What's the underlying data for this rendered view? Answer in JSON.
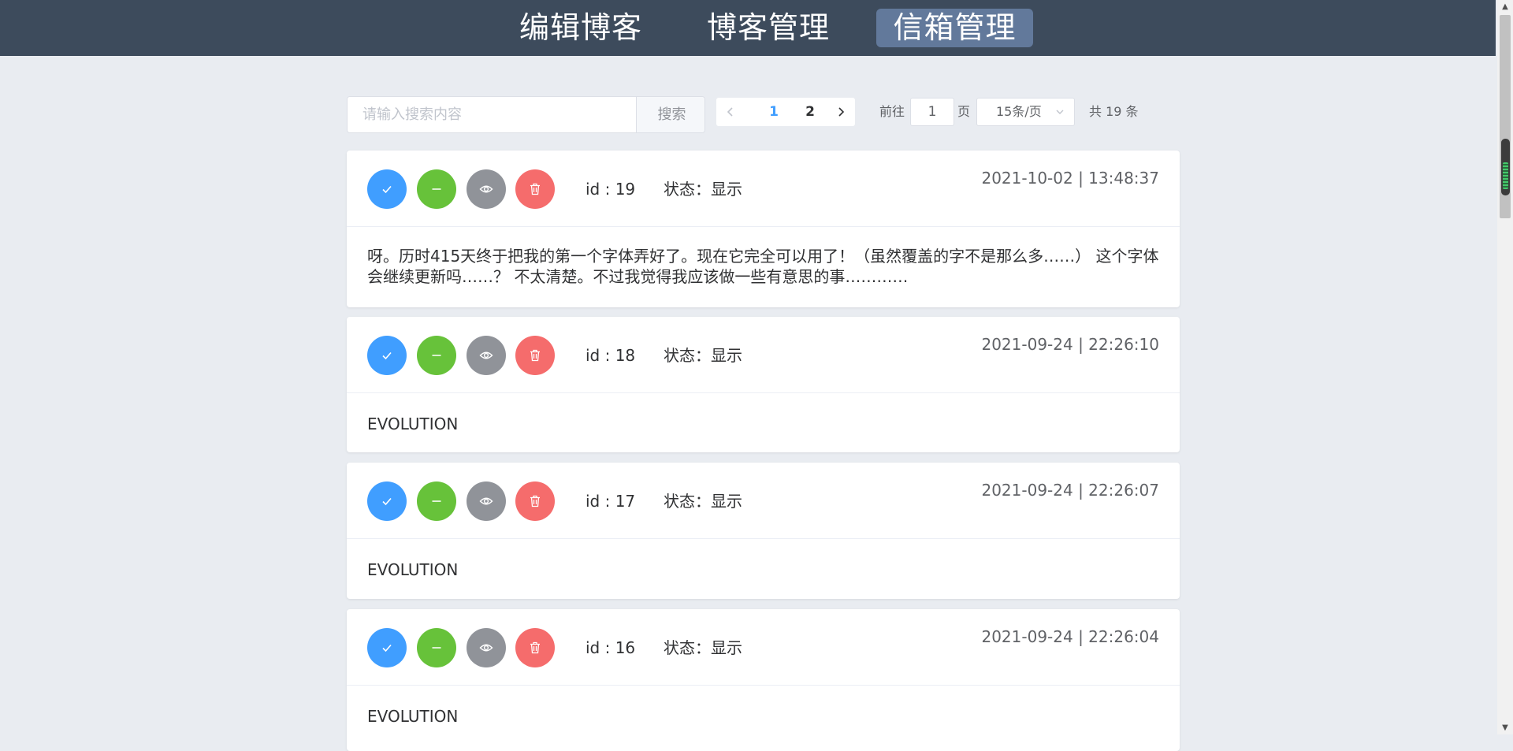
{
  "nav": {
    "items": [
      {
        "label": "编辑博客",
        "active": false
      },
      {
        "label": "博客管理",
        "active": false
      },
      {
        "label": "信箱管理",
        "active": true
      }
    ]
  },
  "toolbar": {
    "search_placeholder": "请输入搜索内容",
    "search_button": "搜索"
  },
  "pagination": {
    "prev_icon": "chevron-left-icon",
    "next_icon": "chevron-right-icon",
    "pages": [
      "1",
      "2"
    ],
    "current_page": "1",
    "goto_label": "前往",
    "goto_value": "1",
    "page_suffix": "页",
    "page_size": "15条/页",
    "total": "共 19 条"
  },
  "card_actions": {
    "approve_icon": "check-icon",
    "hide_icon": "minus-icon",
    "view_icon": "eye-icon",
    "delete_icon": "trash-icon"
  },
  "messages": [
    {
      "id_text": "id : 19",
      "status_text": "状态：显示",
      "date": "2021-10-02 | 13:48:37",
      "content_line1": "呀。历时415天终于把我的第一个字体弄好了。现在它完全可以用了！（虽然覆盖的字不是那么多……） 这个字体",
      "content_line2": "会继续更新吗……？ 不太清楚。不过我觉得我应该做一些有意思的事…………"
    },
    {
      "id_text": "id : 18",
      "status_text": "状态：显示",
      "date": "2021-09-24 | 22:26:10",
      "content_line1": "EVOLUTION"
    },
    {
      "id_text": "id : 17",
      "status_text": "状态：显示",
      "date": "2021-09-24 | 22:26:07",
      "content_line1": "EVOLUTION"
    },
    {
      "id_text": "id : 16",
      "status_text": "状态：显示",
      "date": "2021-09-24 | 22:26:04",
      "content_line1": "EVOLUTION"
    }
  ],
  "colors": {
    "topbar": "#3d4b5c",
    "nav_active": "#62799b",
    "approve": "#409eff",
    "hide": "#67c23a",
    "view": "#909399",
    "delete": "#f56c6c",
    "page_bg": "#e9ecf1"
  }
}
